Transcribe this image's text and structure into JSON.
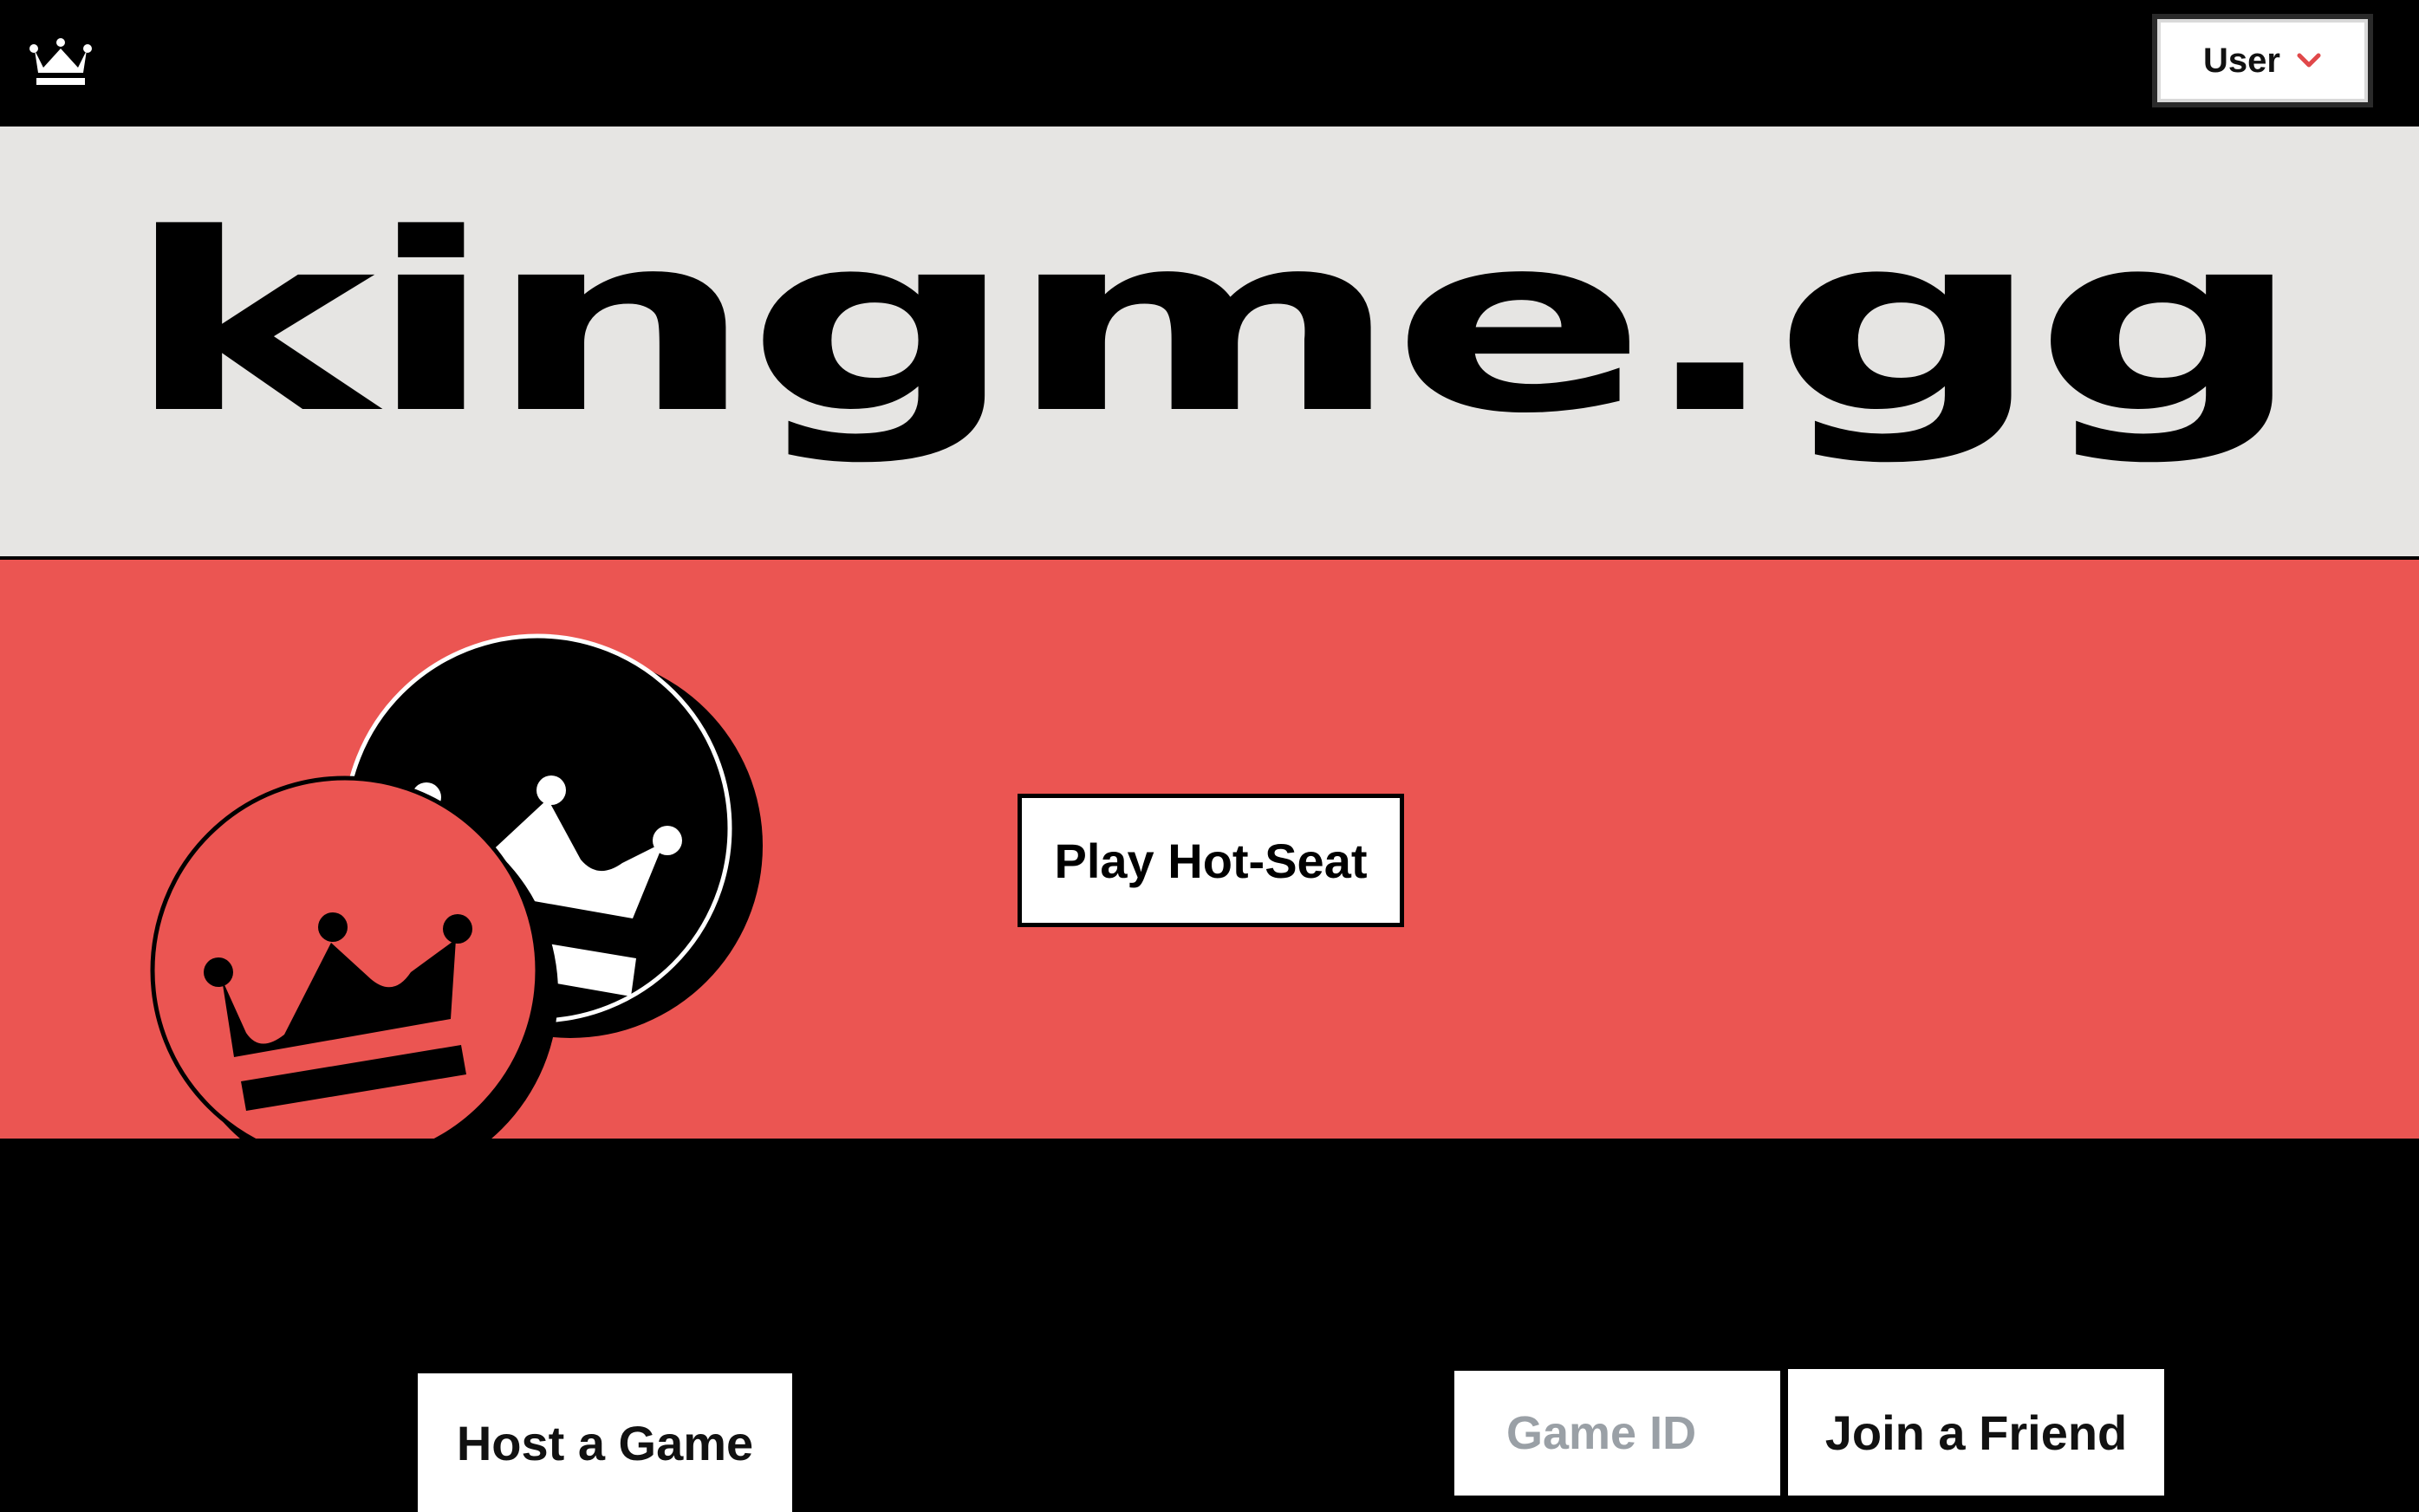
{
  "topbar": {
    "logo_icon": "crown-icon",
    "user_label": "User",
    "user_chevron_icon": "chevron-down-icon",
    "chevron_color": "#e0484a"
  },
  "hero": {
    "brand": "kingme.gg"
  },
  "main": {
    "hotseat_label": "Play Hot-Seat",
    "illustration": "checker-pieces-crowns"
  },
  "bottom": {
    "host_label": "Host a Game",
    "game_id_placeholder": "Game ID",
    "join_label": "Join a Friend"
  },
  "colors": {
    "accent_red": "#eb5552",
    "hero_bg": "#e6e5e3",
    "dark": "#000000"
  }
}
